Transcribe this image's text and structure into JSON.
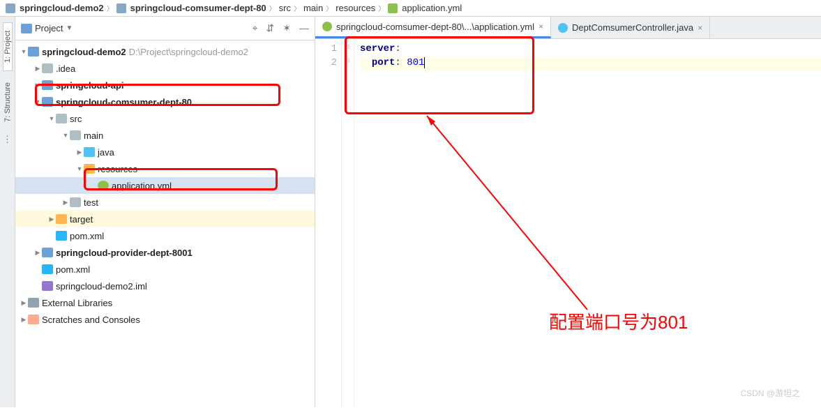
{
  "breadcrumbs": [
    "springcloud-demo2",
    "springcloud-comsumer-dept-80",
    "src",
    "main",
    "resources",
    "application.yml"
  ],
  "project_panel": {
    "title": "Project",
    "tools": {
      "target": "⌖",
      "collapse": "⇵",
      "settings": "✶",
      "hide": "—"
    }
  },
  "tree": {
    "root": {
      "label": "springcloud-demo2",
      "path": "D:\\Project\\springcloud-demo2"
    },
    "idea": ".idea",
    "api": "springcloud-api",
    "consumer": "springcloud-comsumer-dept-80",
    "src": "src",
    "main_dir": "main",
    "java_dir": "java",
    "resources": "resources",
    "app_yml": "application.yml",
    "test_dir": "test",
    "target_dir": "target",
    "pom1": "pom.xml",
    "provider": "springcloud-provider-dept-8001",
    "pom2": "pom.xml",
    "iml": "springcloud-demo2.iml",
    "external": "External Libraries",
    "scratches": "Scratches and Consoles"
  },
  "tabs": [
    {
      "label": "springcloud-comsumer-dept-80\\...\\application.yml",
      "icon": "yml",
      "active": true
    },
    {
      "label": "DeptComsumerController.java",
      "icon": "java",
      "active": false
    }
  ],
  "code": {
    "line1_key": "server",
    "line2_key": "port",
    "line2_val": "801",
    "line_numbers": [
      "1",
      "2"
    ]
  },
  "side_tabs": {
    "project": "1: Project",
    "structure": "7: Structure"
  },
  "annotation_text": "配置端口号为801",
  "watermark": "CSDN @游坦之",
  "chart_data": null
}
